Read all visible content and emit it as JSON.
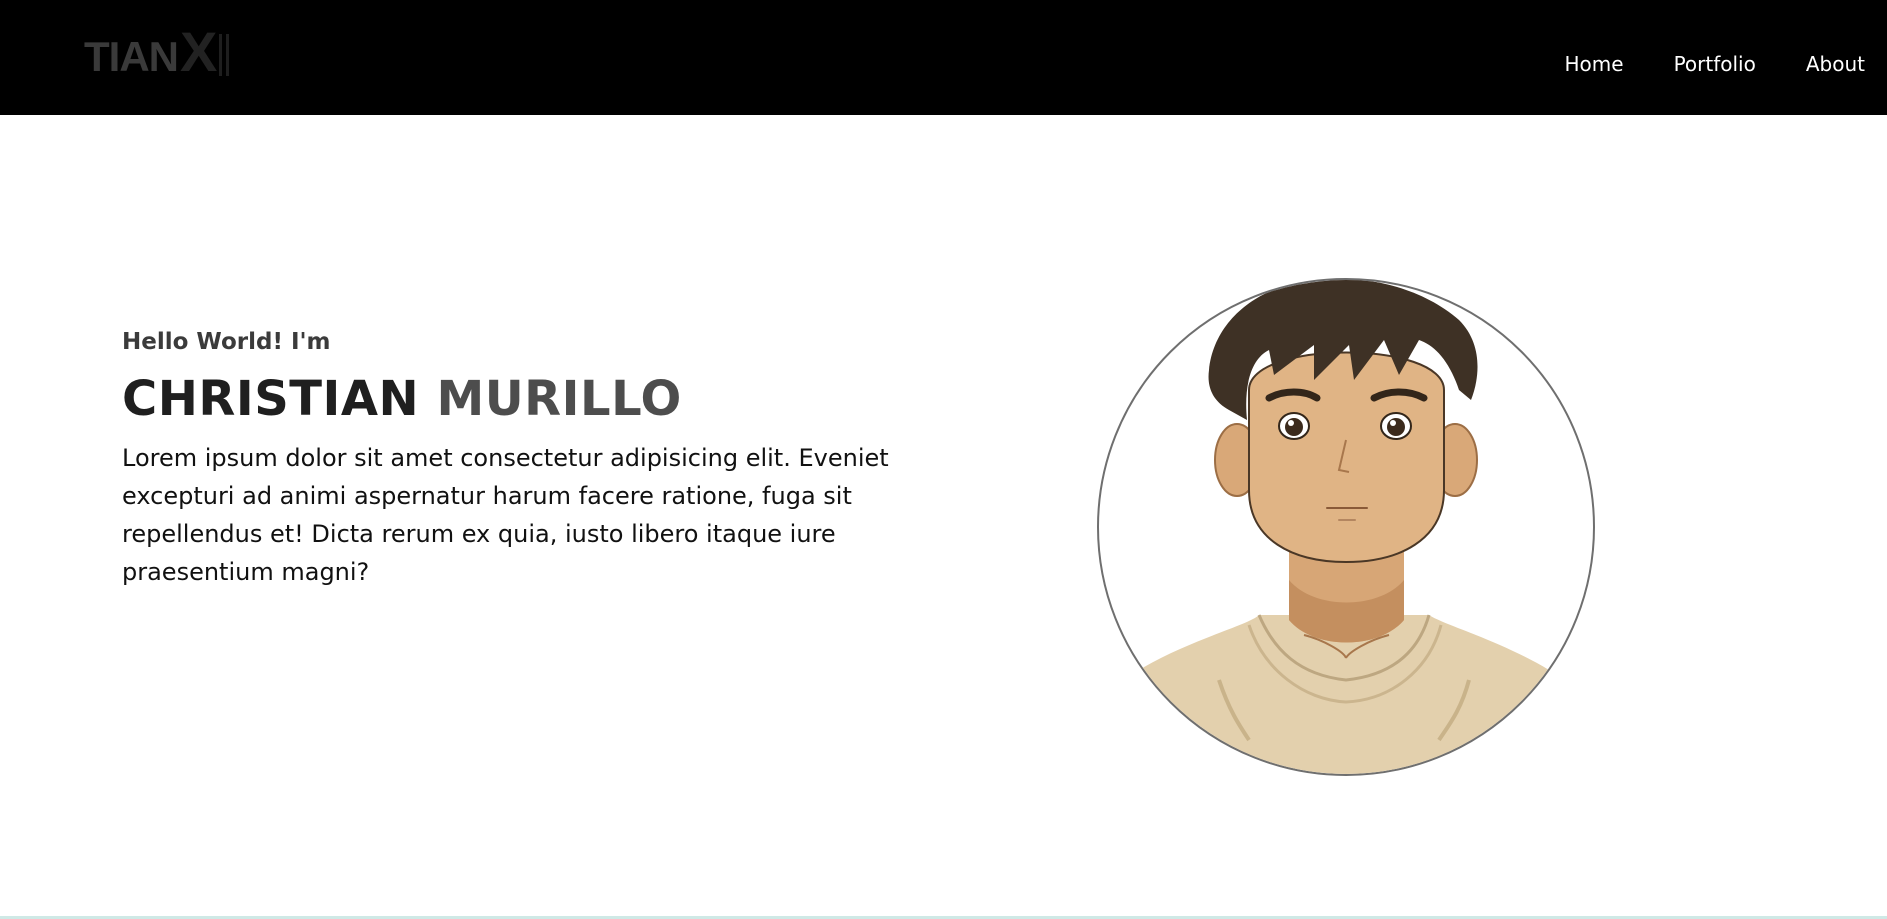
{
  "header": {
    "logo_text": "TIAN",
    "logo_mark": "X",
    "nav": [
      {
        "label": "Home"
      },
      {
        "label": "Portfolio"
      },
      {
        "label": "About"
      }
    ]
  },
  "hero": {
    "greeting": "Hello World! I'm",
    "first_name": "CHRISTIAN",
    "last_name": "MURILLO",
    "bio": "Lorem ipsum dolor sit amet consectetur adipisicing elit. Eveniet excepturi ad animi aspernatur harum facere ratione, fuga sit repellendus et! Dicta rerum ex quia, iusto libero itaque iure praesentium magni?",
    "portrait_icon": "avatar-illustration"
  },
  "colors": {
    "navbar_bg": "#000000",
    "page_bg": "#ffffff",
    "nav_text": "#ffffff",
    "heading_dark": "#1f1f1f",
    "heading_light": "#4d4d4d"
  }
}
